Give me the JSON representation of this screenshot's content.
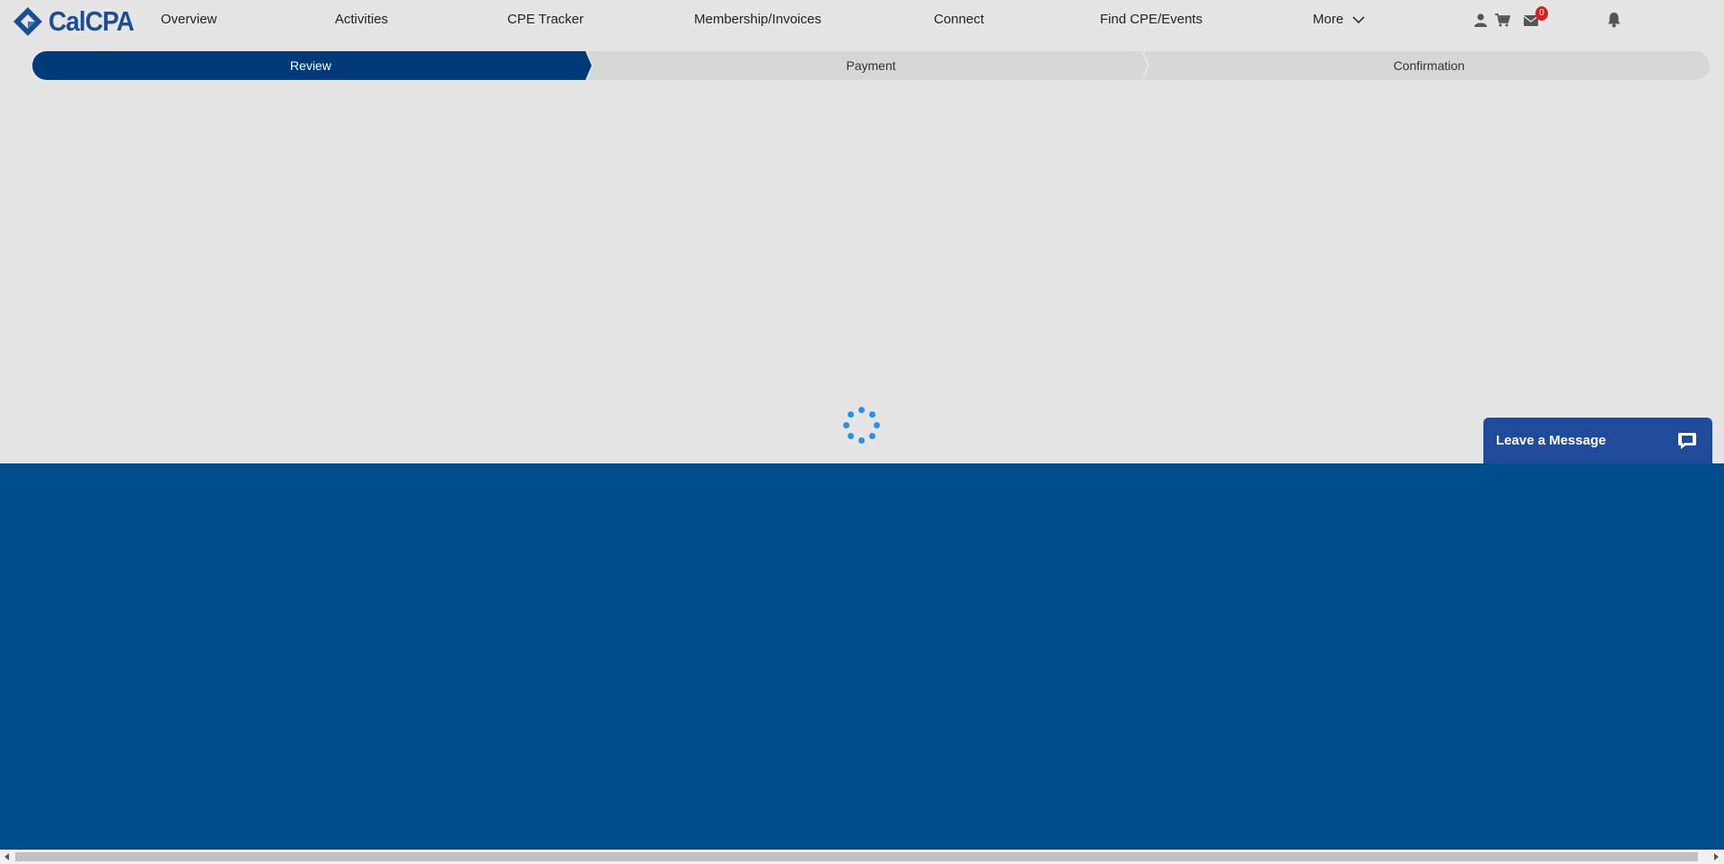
{
  "brand": {
    "name": "CalCPA"
  },
  "nav": {
    "items": [
      "Overview",
      "Activities",
      "CPE Tracker",
      "Membership/Invoices",
      "Connect",
      "Find CPE/Events"
    ],
    "more_label": "More",
    "messages_count": "0",
    "icons": [
      "user-icon",
      "cart-icon",
      "mail-icon",
      "bell-icon"
    ]
  },
  "steps": {
    "items": [
      "Review",
      "Payment",
      "Confirmation"
    ],
    "active": "Review"
  },
  "chat": {
    "label": "Leave a Message",
    "icon": "chat-bubble-icon"
  },
  "colors": {
    "brand": "#1b4f8f",
    "active_step": "#003a78",
    "inactive_step": "#d7d7d7",
    "footer": "#004d8c",
    "spinner": "#2f8fe0",
    "badge": "#d81f1f"
  }
}
